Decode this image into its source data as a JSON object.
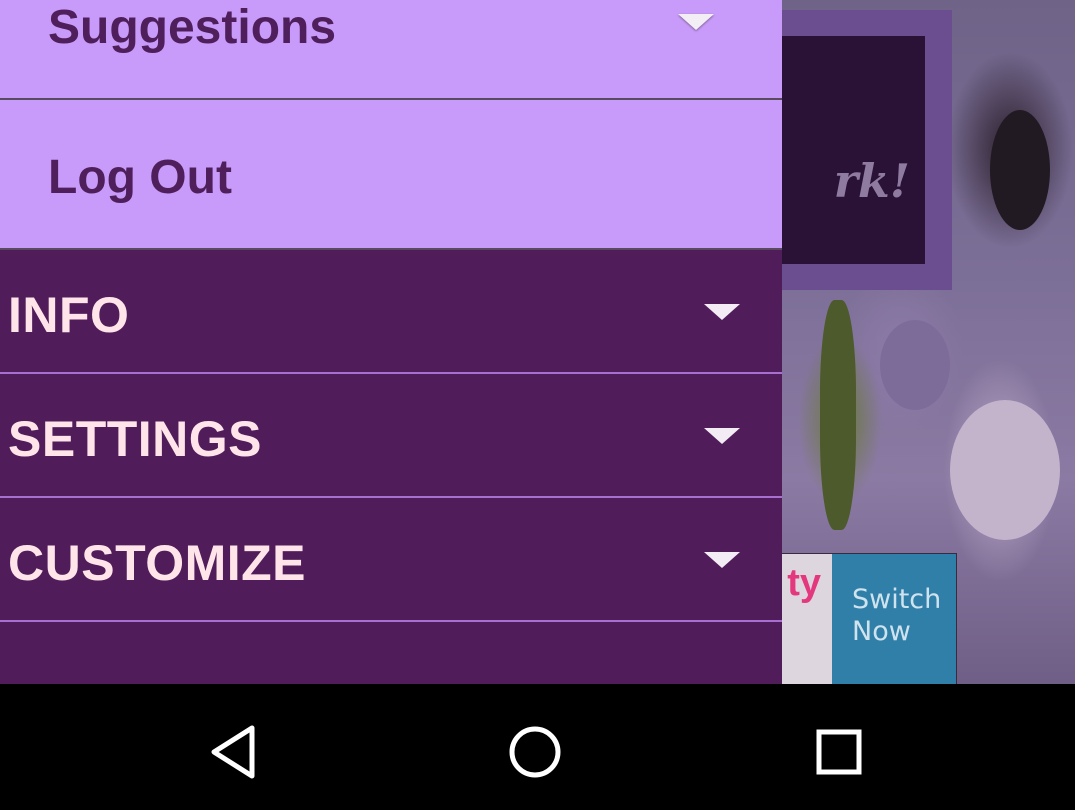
{
  "background": {
    "card_text": "rk!",
    "ad": {
      "left_text": "ty",
      "button_label_line1": "Switch",
      "button_label_line2": "Now"
    }
  },
  "drawer": {
    "items_light": [
      {
        "label": "Suggestions",
        "icon": "chevron-down-icon"
      },
      {
        "label": "Log Out"
      }
    ],
    "items_dark": [
      {
        "label": "INFO",
        "icon": "chevron-down-icon"
      },
      {
        "label": "SETTINGS",
        "icon": "chevron-down-icon"
      },
      {
        "label": "CUSTOMIZE",
        "icon": "chevron-down-icon"
      }
    ]
  },
  "navbar": {
    "back_icon": "back-triangle-icon",
    "home_icon": "home-circle-icon",
    "recents_icon": "recents-square-icon"
  },
  "colors": {
    "drawer_dark": "#511c5a",
    "drawer_light": "#c89bfb",
    "dark_label": "#ffe4ea",
    "light_label": "#4e1f5a"
  }
}
